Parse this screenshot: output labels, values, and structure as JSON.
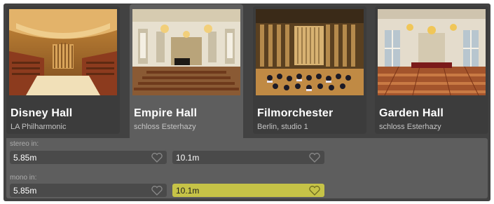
{
  "halls": [
    {
      "name": "Disney Hall",
      "subtitle": "LA Philharmonic",
      "selected": false
    },
    {
      "name": "Empire Hall",
      "subtitle": "schloss Esterhazy",
      "selected": true
    },
    {
      "name": "Filmorchester",
      "subtitle": "Berlin, studio 1",
      "selected": false
    },
    {
      "name": "Garden Hall",
      "subtitle": "schloss Esterhazy",
      "selected": false
    }
  ],
  "stereo": {
    "label": "stereo in:",
    "options": [
      "5.85m",
      "10.1m"
    ],
    "selected": null
  },
  "mono": {
    "label": "mono in:",
    "options": [
      "5.85m",
      "10.1m"
    ],
    "selected": "10.1m"
  },
  "colors": {
    "background": "#424242",
    "selected_tab": "#5e5e5e",
    "field": "#4a4a4a",
    "active_field": "#c6c347"
  },
  "icons": [
    "heart-icon"
  ]
}
